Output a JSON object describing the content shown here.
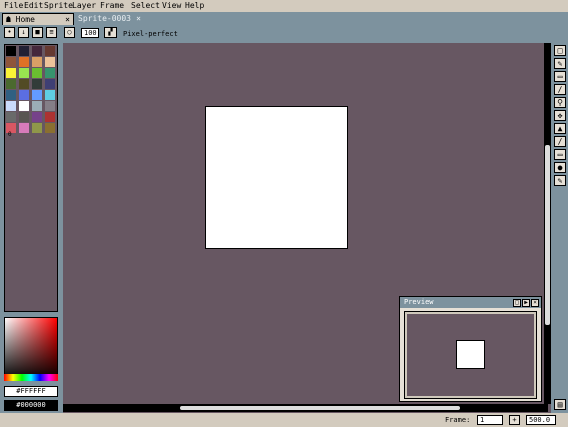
{
  "menu": [
    "File",
    "Edit",
    "Sprite",
    "Layer",
    "Frame",
    "Select",
    "View",
    "Help"
  ],
  "tabs": [
    {
      "label": "Home",
      "icon": "home-icon",
      "close": "×",
      "active": true
    },
    {
      "label": "Sprite-0003",
      "close": "×",
      "active": false
    }
  ],
  "toolbar": {
    "opacity_value": "100",
    "pixel_perfect_label": "Pixel-perfect"
  },
  "palette": {
    "colors": [
      "#000000",
      "#222034",
      "#45283c",
      "#663931",
      "#8f563b",
      "#df7126",
      "#d9a066",
      "#eec39a",
      "#fbf236",
      "#99e550",
      "#6abe30",
      "#37946e",
      "#4b692f",
      "#524b24",
      "#323c39",
      "#3f3f74",
      "#306082",
      "#5b6ee1",
      "#639bff",
      "#5fcde4",
      "#cbdbfc",
      "#ffffff",
      "#9badb7",
      "#847e87",
      "#696a6a",
      "#595652",
      "#76428a",
      "#ac3232",
      "#d95763",
      "#d77bba",
      "#8f974a",
      "#8a6f30"
    ],
    "index_marker": "0"
  },
  "colors": {
    "foreground": "#FFFFFF",
    "background": "#000000"
  },
  "preview": {
    "title": "Preview"
  },
  "status": {
    "frame_label": "Frame:",
    "frame_value": "1",
    "add_frame": "+",
    "zoom": "500.0"
  }
}
